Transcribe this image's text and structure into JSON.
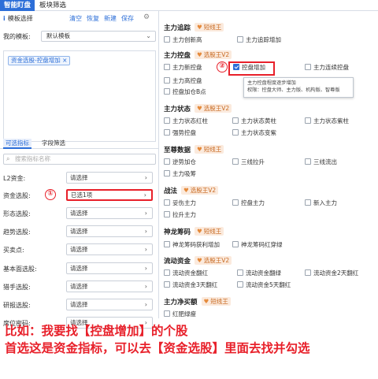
{
  "tabs": [
    "智能盯盘",
    "板块筛选"
  ],
  "left": {
    "header": "模板选择",
    "actions": [
      "清空",
      "恢复",
      "新建",
      "保存"
    ],
    "my_model_label": "我的模板:",
    "my_model_value": "默认模板",
    "chip": "资金选股-控盘增加 ×",
    "subtabs": [
      "可选指标",
      "字段筛选"
    ],
    "search_placeholder": "搜索指标名称",
    "rows": [
      {
        "label": "L2资金:",
        "value": "请选择"
      },
      {
        "label": "资金选股:",
        "value": "已选1项"
      },
      {
        "label": "形态选股:",
        "value": "请选择"
      },
      {
        "label": "趋势选股:",
        "value": "请选择"
      },
      {
        "label": "买卖点:",
        "value": "请选择"
      },
      {
        "label": "基本面选股:",
        "value": "请选择"
      },
      {
        "label": "猎手选股:",
        "value": "请选择"
      },
      {
        "label": "研报选股:",
        "value": "请选择"
      },
      {
        "label": "席位密码:",
        "value": "请选择"
      }
    ],
    "marker": "①"
  },
  "right": {
    "marker": "②",
    "sections": [
      {
        "title": "主力追踪",
        "tag": "短线王",
        "options": [
          "主力创新高",
          "主力追踪增加"
        ]
      },
      {
        "title": "主力控盘",
        "tag": "选股王V2",
        "options": [
          "主力新控盘",
          "控盘增加",
          "主力连续控盘",
          "主力高控盘",
          "控盘加仓B点"
        ]
      },
      {
        "title": "主力状态",
        "tag": "选股王V2",
        "options": [
          "主力状态红柱",
          "主力状态黄柱",
          "主力状态紫柱",
          "强势控盘",
          "主力状态变紫"
        ]
      },
      {
        "title": "至尊数据",
        "tag": "短线王",
        "options": [
          "逆势加仓",
          "三线拉升",
          "三线流出",
          "主力吸筹"
        ]
      },
      {
        "title": "战法",
        "tag": "选股王V2",
        "options": [
          "妥伤主力",
          "控盘主力",
          "新入主力",
          "拉升主力"
        ]
      },
      {
        "title": "神龙筹码",
        "tag": "短线王",
        "options": [
          "神龙筹码获利增加",
          "神龙筹码红穿绿"
        ]
      },
      {
        "title": "流动资金",
        "tag": "选股王V2",
        "options": [
          "流动资金翻红",
          "流动资金翻绿",
          "流动资金2天翻红",
          "流动资金3天翻红",
          "流动资金5天翻红"
        ]
      },
      {
        "title": "主力净买额",
        "tag": "短线王",
        "options": [
          "红肥绿瘦"
        ]
      }
    ],
    "tooltip_line1": "主力控盘程度逐步增加",
    "tooltip_line2": "权限：控盘大师、主力版、机构版、智尊版",
    "hidden_partial": "主力高控盘"
  },
  "bottom": {
    "line1": "比如：我要找【控盘增加】的个股",
    "line2": "首选这是资金指标，可以去【资金选股】里面去找并勾选"
  },
  "colors": {
    "accent": "#2d6fd8",
    "highlight": "#e8202a",
    "tag_bg": "#fbeadd",
    "tag_text": "#c86a22"
  }
}
